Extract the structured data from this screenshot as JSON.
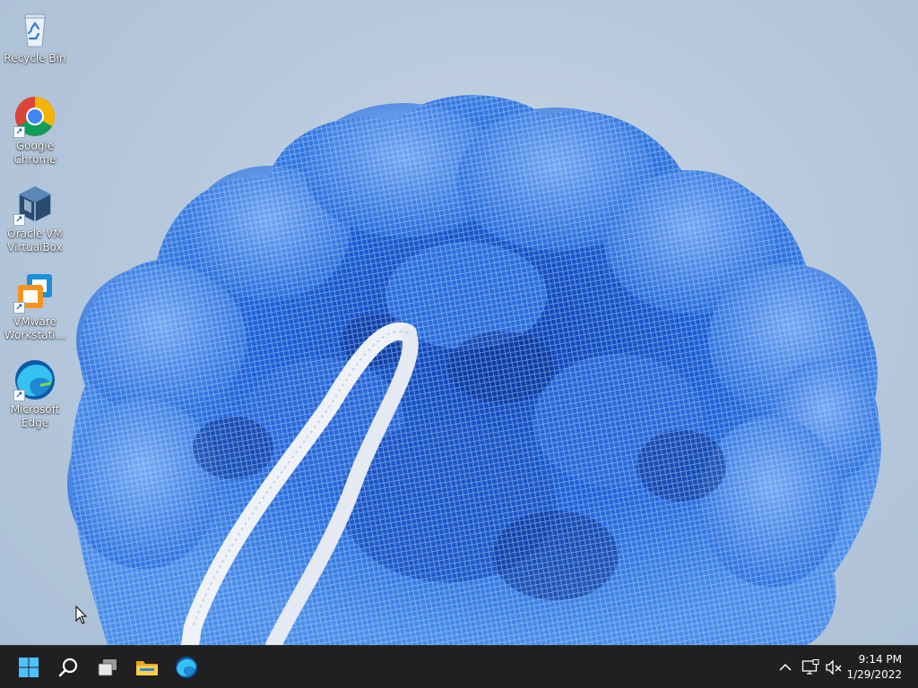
{
  "desktop": {
    "icons": [
      {
        "name": "recycle-bin",
        "label": "Recycle Bin",
        "icon": "recycle-bin-icon"
      },
      {
        "name": "google-chrome",
        "label": "Google\nChrome",
        "icon": "chrome-icon",
        "shortcut": true
      },
      {
        "name": "oracle-vm-virtualbox",
        "label": "Oracle VM\nVirtualBox",
        "icon": "virtualbox-icon",
        "shortcut": true
      },
      {
        "name": "vmware-workstation",
        "label": "VMware\nWorkstati...",
        "icon": "vmware-icon",
        "shortcut": true
      },
      {
        "name": "microsoft-edge",
        "label": "Microsoft\nEdge",
        "icon": "edge-icon",
        "shortcut": true
      }
    ],
    "wallpaper": "blue-mesh-bloom",
    "colors": {
      "accent": "#1e63d6",
      "light_mesh": "#6fa6f0",
      "background": "#b8c9dc"
    }
  },
  "taskbar": {
    "apps": [
      {
        "name": "start",
        "icon": "windows-start-icon"
      },
      {
        "name": "search",
        "icon": "search-icon"
      },
      {
        "name": "task-view",
        "icon": "task-view-icon"
      },
      {
        "name": "file-explorer",
        "icon": "folder-icon"
      },
      {
        "name": "edge",
        "icon": "edge-icon"
      }
    ],
    "tray": {
      "icons": [
        "chevron-up-icon",
        "network-icon",
        "volume-muted-icon"
      ],
      "time": "9:14 PM",
      "date": "1/29/2022"
    }
  }
}
